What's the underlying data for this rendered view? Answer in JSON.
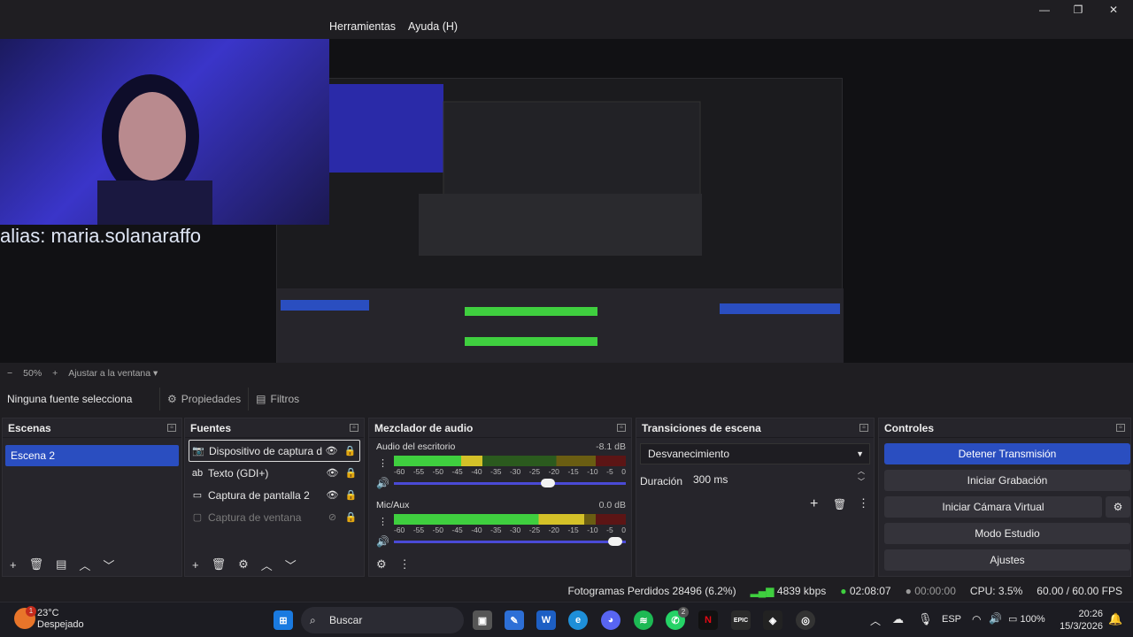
{
  "menu": {
    "tools": "Herramientas",
    "help": "Ayuda (H)"
  },
  "preview": {
    "overlay_text": "alias: maria.solanaraffo",
    "zoom": "50%",
    "fit_label": "Ajustar a la ventana"
  },
  "source_bar": {
    "no_source": "Ninguna fuente selecciona",
    "properties": "Propiedades",
    "filters": "Filtros"
  },
  "scenes": {
    "title": "Escenas",
    "items": [
      "Escena 2"
    ]
  },
  "sources": {
    "title": "Fuentes",
    "items": [
      {
        "name": "Dispositivo de captura de",
        "icon": "camera-icon",
        "visible": true,
        "locked": true
      },
      {
        "name": "Texto (GDI+)",
        "icon": "text-icon",
        "visible": true,
        "locked": true
      },
      {
        "name": "Captura de pantalla 2",
        "icon": "monitor-icon",
        "visible": true,
        "locked": true
      },
      {
        "name": "Captura de ventana",
        "icon": "window-icon",
        "visible": false,
        "locked": true
      }
    ]
  },
  "mixer": {
    "title": "Mezclador de audio",
    "scale": [
      "-60",
      "-55",
      "-50",
      "-45",
      "-40",
      "-35",
      "-30",
      "-25",
      "-20",
      "-15",
      "-10",
      "-5",
      "0"
    ],
    "channels": [
      {
        "name": "Audio del escritorio",
        "db": "-8.1 dB",
        "level": 0.38,
        "volume": 0.68
      },
      {
        "name": "Mic/Aux",
        "db": "0.0 dB",
        "level": 0.82,
        "volume": 0.97
      }
    ]
  },
  "transitions": {
    "title": "Transiciones de escena",
    "type": "Desvanecimiento",
    "duration_label": "Duración",
    "duration": "300 ms"
  },
  "controls": {
    "title": "Controles",
    "stop_stream": "Detener Transmisión",
    "start_recording": "Iniciar Grabación",
    "start_virtual_cam": "Iniciar Cámara Virtual",
    "studio_mode": "Modo Estudio",
    "settings": "Ajustes"
  },
  "status": {
    "dropped": "Fotogramas Perdidos 28496 (6.2%)",
    "bitrate": "4839 kbps",
    "stream_time": "02:08:07",
    "rec_time": "00:00:00",
    "cpu": "CPU: 3.5%",
    "fps": "60.00 / 60.00 FPS"
  },
  "taskbar": {
    "weather_temp": "23°C",
    "weather_desc": "Despejado",
    "weather_badge": "1",
    "search": "Buscar",
    "whatsapp_badge": "2",
    "lang": "ESP",
    "battery": "100%",
    "time": "20:26",
    "date": "15/3/2026"
  },
  "colors": {
    "accent": "#2a4ec0",
    "panel": "#26252b",
    "background": "#1f1e22"
  }
}
